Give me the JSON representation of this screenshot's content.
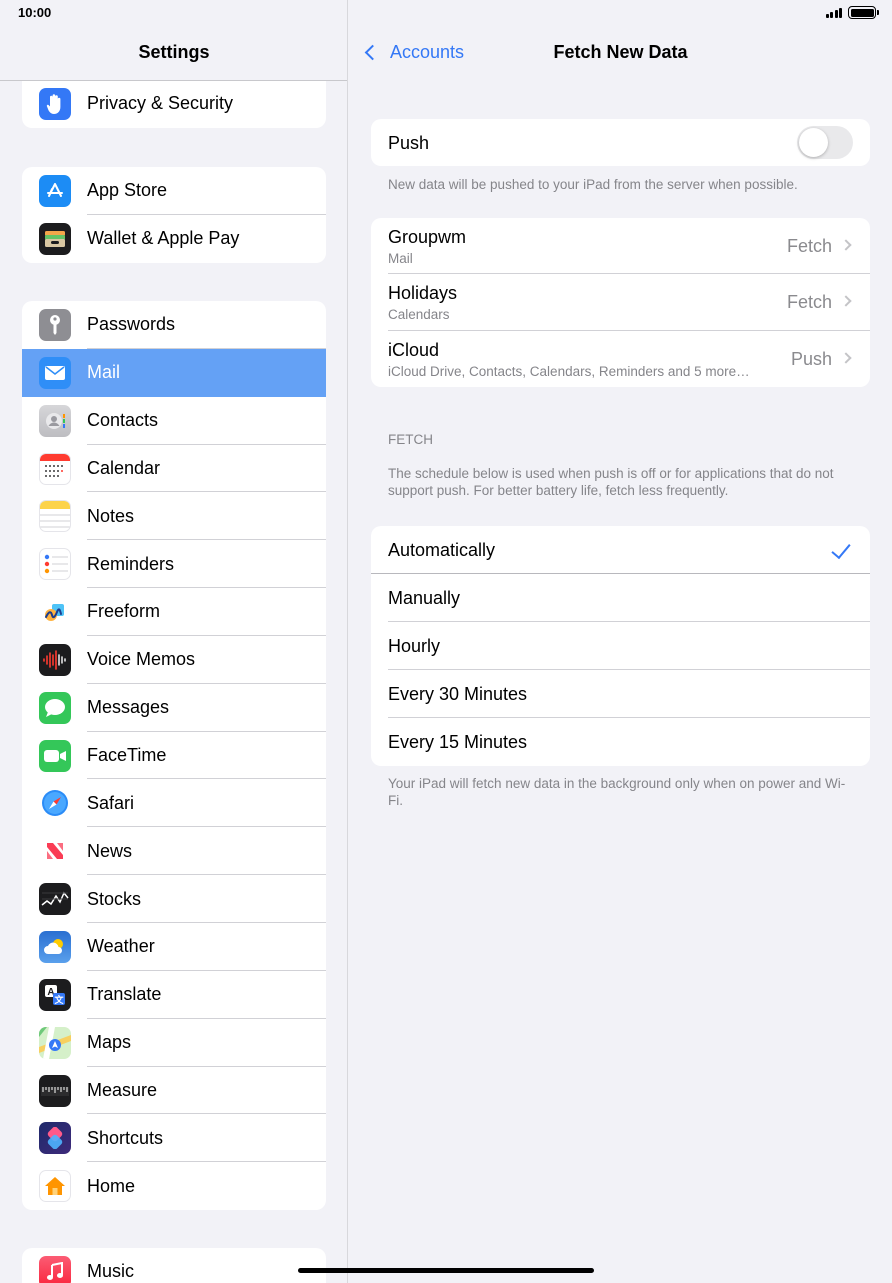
{
  "status": {
    "time": "10:00"
  },
  "sidebar": {
    "title": "Settings",
    "groups": [
      {
        "items": [
          {
            "label": "Privacy & Security",
            "icon": "hand-icon",
            "color": "#3478f6"
          }
        ]
      },
      {
        "items": [
          {
            "label": "App Store",
            "icon": "app-store-icon",
            "color": "#1c8cf5"
          },
          {
            "label": "Wallet & Apple Pay",
            "icon": "wallet-icon",
            "color": "#1c1c1e"
          }
        ]
      },
      {
        "items": [
          {
            "label": "Passwords",
            "icon": "key-icon",
            "color": "#8e8e93"
          },
          {
            "label": "Mail",
            "icon": "envelope-icon",
            "color": "#2f8ef7",
            "selected": true
          },
          {
            "label": "Contacts",
            "icon": "contacts-icon",
            "color": "#c8c8cc"
          },
          {
            "label": "Calendar",
            "icon": "calendar-icon",
            "color": "#ffffff"
          },
          {
            "label": "Notes",
            "icon": "notes-icon",
            "color": "#ffffff"
          },
          {
            "label": "Reminders",
            "icon": "reminders-icon",
            "color": "#ffffff"
          },
          {
            "label": "Freeform",
            "icon": "freeform-icon",
            "color": "#ffffff"
          },
          {
            "label": "Voice Memos",
            "icon": "waveform-icon",
            "color": "#1c1c1e"
          },
          {
            "label": "Messages",
            "icon": "message-bubble-icon",
            "color": "#34c759"
          },
          {
            "label": "FaceTime",
            "icon": "video-camera-icon",
            "color": "#34c759"
          },
          {
            "label": "Safari",
            "icon": "compass-icon",
            "color": "#ffffff"
          },
          {
            "label": "News",
            "icon": "news-icon",
            "color": "#ffffff"
          },
          {
            "label": "Stocks",
            "icon": "stocks-chart-icon",
            "color": "#1c1c1e"
          },
          {
            "label": "Weather",
            "icon": "cloud-sun-icon",
            "color": "#3b7bd9"
          },
          {
            "label": "Translate",
            "icon": "translate-icon",
            "color": "#1c1c1e"
          },
          {
            "label": "Maps",
            "icon": "map-icon",
            "color": "#6fc97a"
          },
          {
            "label": "Measure",
            "icon": "ruler-icon",
            "color": "#1c1c1e"
          },
          {
            "label": "Shortcuts",
            "icon": "shortcuts-icon",
            "color": "#3a3a8c"
          },
          {
            "label": "Home",
            "icon": "house-icon",
            "color": "#ffffff"
          }
        ]
      },
      {
        "items": [
          {
            "label": "Music",
            "icon": "music-note-icon",
            "color": "#fa3c55"
          }
        ]
      }
    ]
  },
  "detail": {
    "back_label": "Accounts",
    "title": "Fetch New Data",
    "push": {
      "label": "Push",
      "enabled": false,
      "footnote": "New data will be pushed to your iPad from the server when possible."
    },
    "accounts": [
      {
        "name": "Groupwm",
        "subtitle": "Mail",
        "value": "Fetch"
      },
      {
        "name": "Holidays",
        "subtitle": "Calendars",
        "value": "Fetch"
      },
      {
        "name": "iCloud",
        "subtitle": "iCloud Drive, Contacts, Calendars, Reminders and 5 more…",
        "value": "Push"
      }
    ],
    "fetch_header": "FETCH",
    "fetch_description": "The schedule below is used when push is off or for applications that do not support push. For better battery life, fetch less frequently.",
    "fetch_options": [
      {
        "label": "Automatically",
        "selected": true
      },
      {
        "label": "Manually",
        "selected": false
      },
      {
        "label": "Hourly",
        "selected": false
      },
      {
        "label": "Every 30 Minutes",
        "selected": false
      },
      {
        "label": "Every 15 Minutes",
        "selected": false
      }
    ],
    "fetch_footnote": "Your iPad will fetch new data in the background only when on power and Wi-Fi."
  },
  "colors": {
    "accent": "#3478f6",
    "selection": "#64a1f5",
    "background": "#f2f2f7"
  }
}
